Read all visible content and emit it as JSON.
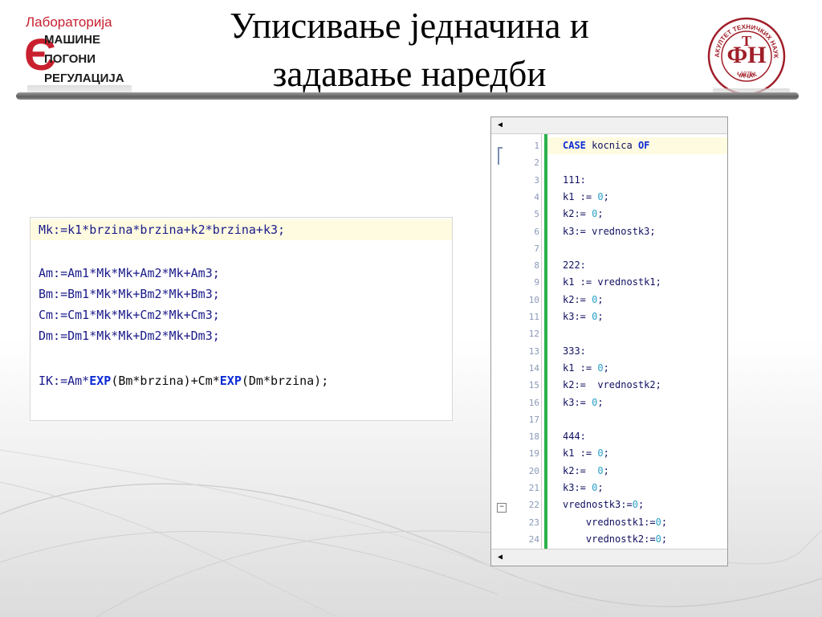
{
  "slide": {
    "title_line1": "Уписивање једначина и",
    "title_line2": "задавање наредби"
  },
  "logo_left": {
    "top": "Лабораторија",
    "line1": "АШИНЕ",
    "line2": "ОГОНИ",
    "line3": "ЕГУЛАЦИЈА"
  },
  "seal": {
    "ring_text_top": "ФАКУЛТЕТ ТЕХНИЧКИХ НАУКА",
    "ring_text_bottom": "ЧАЧАК",
    "year": "1975"
  },
  "left_code": {
    "lines": [
      "Mk:=k1*brzina*brzina+k2*brzina+k3;",
      "",
      "Am:=Am1*Mk*Mk+Am2*Mk+Am3;",
      "Bm:=Bm1*Mk*Mk+Bm2*Mk+Bm3;",
      "Cm:=Cm1*Mk*Mk+Cm2*Mk+Cm3;",
      "Dm:=Dm1*Mk*Mk+Dm2*Mk+Dm3;",
      "",
      "IK:=Am*EXP(Bm*brzina)+Cm*EXP(Dm*brzina);"
    ],
    "ik_parts": [
      "IK:=Am*",
      "EXP",
      "(Bm*brzina)+Cm*",
      "EXP",
      "(Dm*brzina);"
    ]
  },
  "editor": {
    "lines": [
      {
        "n": "1",
        "text": "CASE kocnica OF"
      },
      {
        "n": "2",
        "text": ""
      },
      {
        "n": "3",
        "text": "111:"
      },
      {
        "n": "4",
        "text": "k1 := 0;"
      },
      {
        "n": "5",
        "text": "k2:= 0;"
      },
      {
        "n": "6",
        "text": "k3:= vrednostk3;"
      },
      {
        "n": "7",
        "text": ""
      },
      {
        "n": "8",
        "text": "222:"
      },
      {
        "n": "9",
        "text": "k1 := vrednostk1;"
      },
      {
        "n": "10",
        "text": "k2:= 0;"
      },
      {
        "n": "11",
        "text": "k3:= 0;"
      },
      {
        "n": "12",
        "text": ""
      },
      {
        "n": "13",
        "text": "333:"
      },
      {
        "n": "14",
        "text": "k1 := 0;"
      },
      {
        "n": "15",
        "text": "k2:=  vrednostk2;"
      },
      {
        "n": "16",
        "text": "k3:= 0;"
      },
      {
        "n": "17",
        "text": ""
      },
      {
        "n": "18",
        "text": "444:"
      },
      {
        "n": "19",
        "text": "k1 := 0;"
      },
      {
        "n": "20",
        "text": "k2:=  0;"
      },
      {
        "n": "21",
        "text": "k3:= 0;"
      },
      {
        "n": "22",
        "text": "vrednostk3:=0;"
      },
      {
        "n": "23",
        "text": "    vrednostk1:=0;"
      },
      {
        "n": "24",
        "text": "    vrednostk2:=0;"
      }
    ],
    "kw_case": "CASE",
    "kw_of": "OF",
    "case_mid": " kocnica "
  },
  "colors": {
    "accent_red": "#c8202f",
    "code_blue": "#1a1a8a",
    "keyword_blue": "#0b2bd6",
    "number_cyan": "#2aa0c8",
    "highlight": "#fffbe0",
    "change_bar": "#2bb24c"
  }
}
